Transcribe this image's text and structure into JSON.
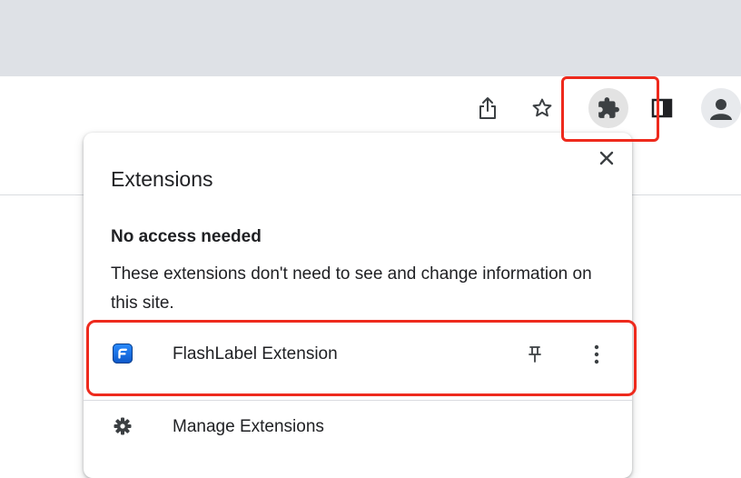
{
  "toolbar": {
    "icons": [
      "share-icon",
      "star-icon",
      "puzzle-icon",
      "side-panel-icon",
      "profile-icon"
    ]
  },
  "popup": {
    "title": "Extensions",
    "section_heading": "No access needed",
    "section_description": "These extensions don't need to see and change information on this site.",
    "extensions": [
      {
        "name": "FlashLabel Extension",
        "icon": "flashlabel-logo-icon"
      }
    ],
    "manage_label": "Manage Extensions"
  },
  "colors": {
    "highlight": "#ee2a1d",
    "tabstrip": "#dee1e6",
    "extension_logo": "#1a73e8"
  }
}
